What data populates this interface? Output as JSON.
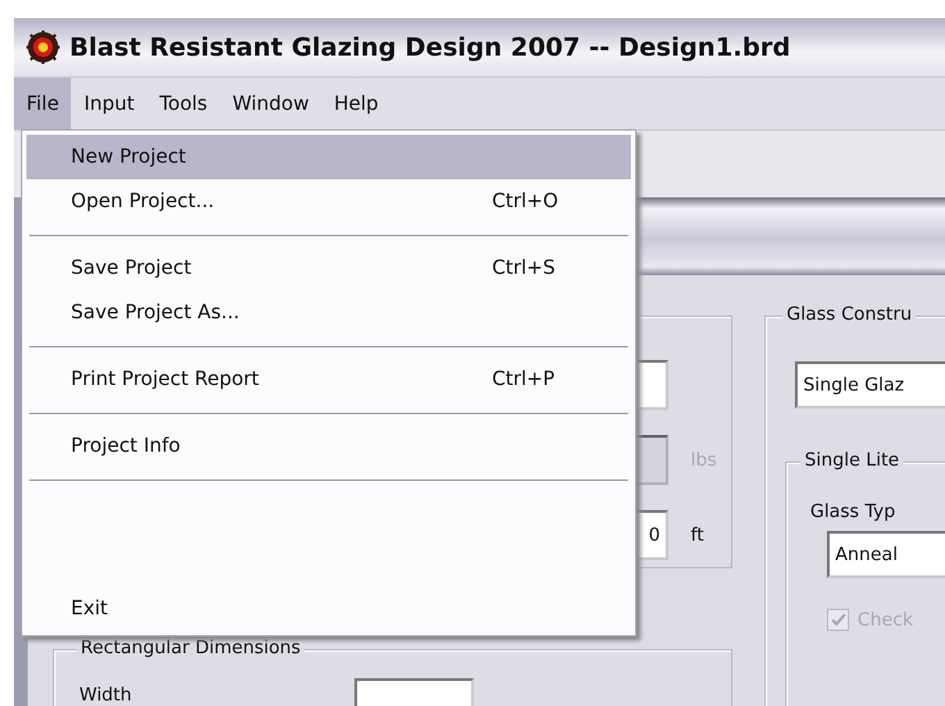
{
  "window": {
    "title": "Blast Resistant Glazing Design 2007 -- Design1.brd"
  },
  "menubar": [
    {
      "label": "File",
      "selected": true
    },
    {
      "label": "Input",
      "selected": false
    },
    {
      "label": "Tools",
      "selected": false
    },
    {
      "label": "Window",
      "selected": false
    },
    {
      "label": "Help",
      "selected": false
    }
  ],
  "file_menu": [
    {
      "kind": "item",
      "label": "New Project",
      "selected": true
    },
    {
      "kind": "item",
      "label": "Open Project...",
      "shortcut": "Ctrl+O",
      "selected": false
    },
    {
      "kind": "separator"
    },
    {
      "kind": "item",
      "label": "Save Project",
      "shortcut": "Ctrl+S",
      "selected": false
    },
    {
      "kind": "item",
      "label": "Save Project As...",
      "selected": false
    },
    {
      "kind": "separator"
    },
    {
      "kind": "item",
      "label": "Print Project Report",
      "shortcut": "Ctrl+P",
      "selected": false
    },
    {
      "kind": "separator"
    },
    {
      "kind": "item",
      "label": "Project Info",
      "selected": false
    },
    {
      "kind": "separator"
    },
    {
      "kind": "spacer"
    },
    {
      "kind": "item",
      "label": "Exit",
      "selected": false
    }
  ],
  "load_fields": [
    {
      "disabled": false
    },
    {
      "unit": "lbs",
      "disabled": true
    },
    {
      "value": "0",
      "unit": "ft",
      "disabled": false
    }
  ],
  "rectangular_dimensions": {
    "title": "Rectangular Dimensions",
    "width_label": "Width"
  },
  "glass_construction": {
    "title": "Glass Constru",
    "type": "Single Glaz",
    "single_lite": {
      "title": "Single Lite",
      "glass_type_label": "Glass Typ",
      "glass_type": "Anneal",
      "check": {
        "label": "Check",
        "checked": true,
        "disabled": true
      }
    }
  }
}
